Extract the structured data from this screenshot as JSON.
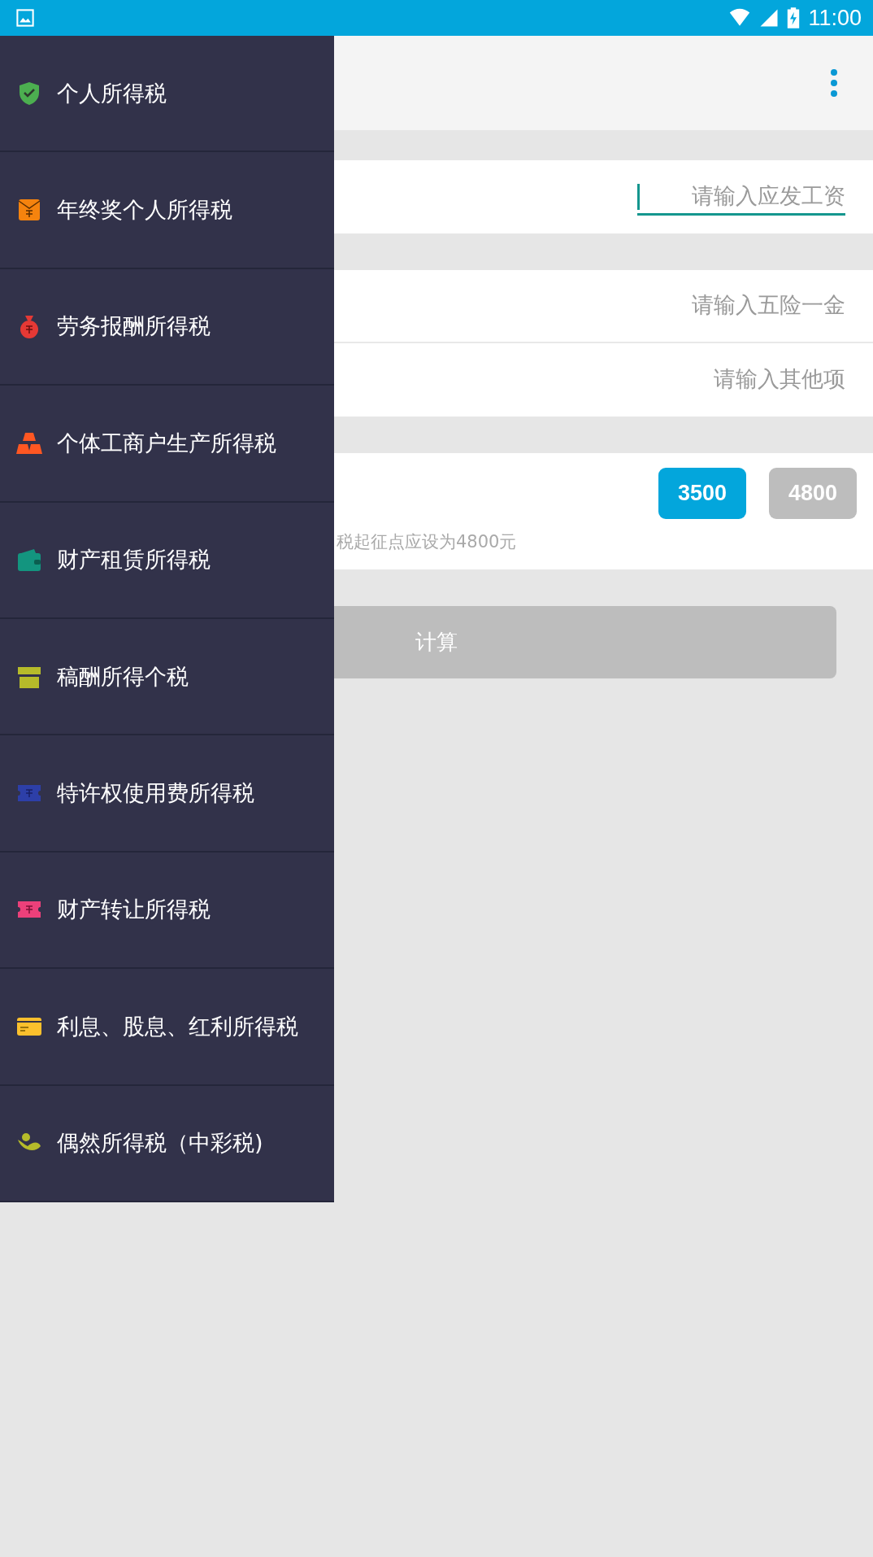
{
  "status_bar": {
    "time": "11:00"
  },
  "drawer": {
    "items": [
      {
        "label": "个人所得税"
      },
      {
        "label": "年终奖个人所得税"
      },
      {
        "label": "劳务报酬所得税"
      },
      {
        "label": "个体工商户生产所得税"
      },
      {
        "label": "财产租赁所得税"
      },
      {
        "label": "稿酬所得个税"
      },
      {
        "label": "特许权使用费所得税"
      },
      {
        "label": "财产转让所得税"
      },
      {
        "label": "利息、股息、红利所得税"
      },
      {
        "label": "偶然所得税（中彩税)"
      }
    ]
  },
  "form": {
    "salary": {
      "placeholder": "请输入应发工资",
      "focused": true
    },
    "deductions": [
      {
        "placeholder": "请输入五险一金",
        "focused": false
      },
      {
        "placeholder": "请输入其他项",
        "focused": false
      }
    ],
    "threshold_options": [
      {
        "label": "3500",
        "selected": true
      },
      {
        "label": "4800",
        "selected": false
      }
    ],
    "hint": "税起征点应设为4800元",
    "calculate_button": "计算"
  }
}
